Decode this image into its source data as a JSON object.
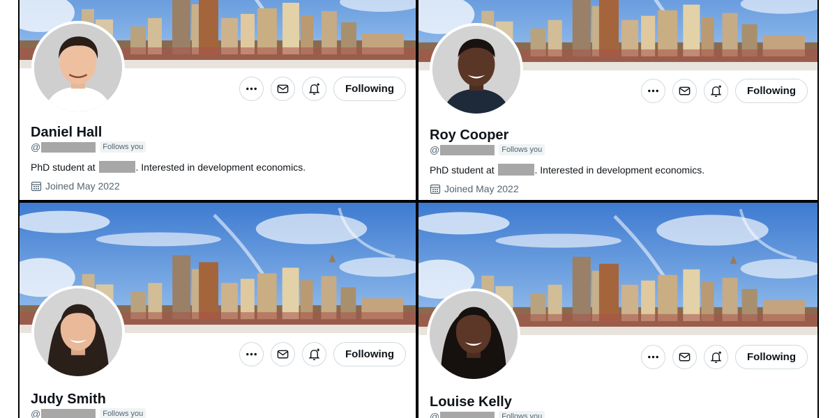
{
  "colors": {
    "sky": "#5b8fd6",
    "border": "#cfd9de",
    "name_text": "#0f1419",
    "muted_text": "#536471",
    "redaction": "#a7a7a7"
  },
  "icons": [
    "more-icon",
    "mail-icon",
    "bell-plus-icon",
    "calendar-icon"
  ],
  "common": {
    "following_label": "Following",
    "follows_you": "Follows you",
    "at_sign": "@",
    "bio_prefix": "PhD student at",
    "bio_suffix": ". Interested in development economics.",
    "joined": "Joined May 2022"
  },
  "profiles": [
    {
      "name": "Daniel Hall"
    },
    {
      "name": "Roy Cooper"
    },
    {
      "name": "Judy Smith"
    },
    {
      "name": "Louise Kelly"
    }
  ]
}
